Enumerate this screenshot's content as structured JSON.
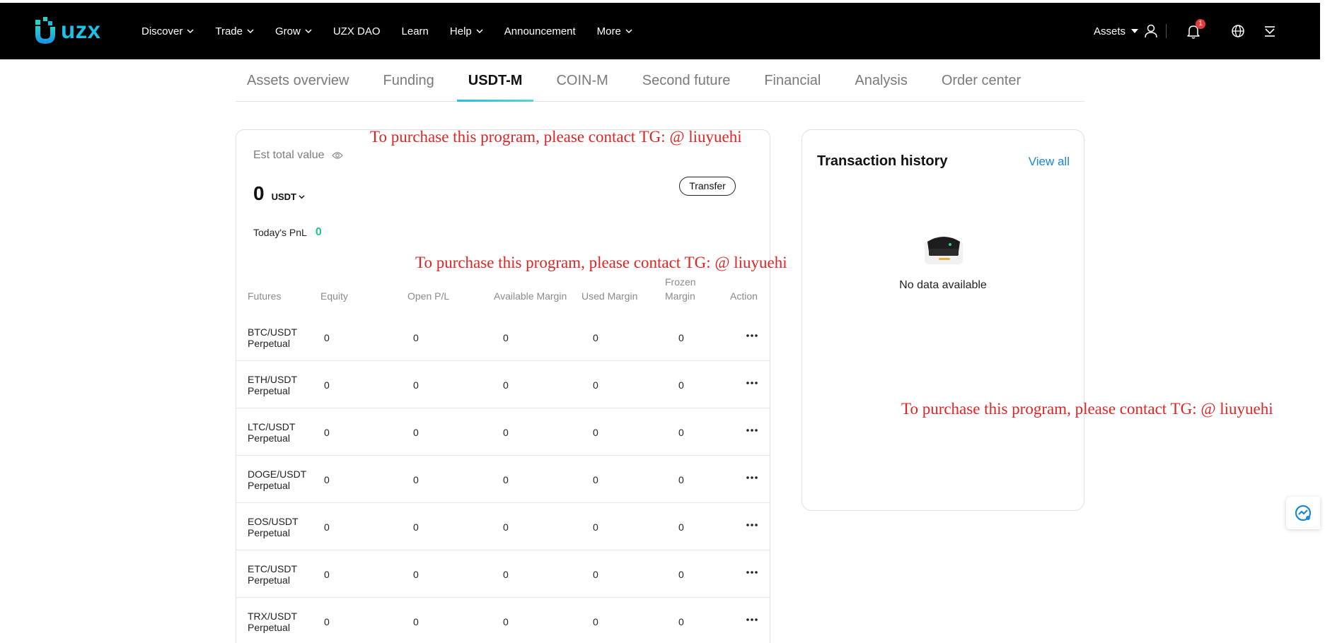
{
  "brand": {
    "name": "uzx"
  },
  "nav": {
    "items": [
      {
        "label": "Discover",
        "has_dropdown": true
      },
      {
        "label": "Trade",
        "has_dropdown": true
      },
      {
        "label": "Grow",
        "has_dropdown": true
      },
      {
        "label": "UZX DAO",
        "has_dropdown": false
      },
      {
        "label": "Learn",
        "has_dropdown": false
      },
      {
        "label": "Help",
        "has_dropdown": true
      },
      {
        "label": "Announcement",
        "has_dropdown": false
      },
      {
        "label": "More",
        "has_dropdown": true
      }
    ],
    "assets_label": "Assets",
    "notification_count": "1",
    "icons": [
      "user-icon",
      "bell-icon",
      "globe-icon",
      "download-icon"
    ]
  },
  "tabs": [
    {
      "label": "Assets overview",
      "active": false
    },
    {
      "label": "Funding",
      "active": false
    },
    {
      "label": "USDT-M",
      "active": true
    },
    {
      "label": "COIN-M",
      "active": false
    },
    {
      "label": "Second future",
      "active": false
    },
    {
      "label": "Financial",
      "active": false
    },
    {
      "label": "Analysis",
      "active": false
    },
    {
      "label": "Order center",
      "active": false
    }
  ],
  "summary": {
    "est_label": "Est total value",
    "value": "0",
    "unit": "USDT",
    "transfer_label": "Transfer",
    "pnl_label": "Today's PnL",
    "pnl_value": "0",
    "pnl_color": "#23c28e"
  },
  "table": {
    "headers": {
      "futures": "Futures",
      "equity": "Equity",
      "open_pl": "Open P/L",
      "available_margin": "Available Margin",
      "used_margin": "Used Margin",
      "frozen_margin_1": "Frozen",
      "frozen_margin_2": "Margin",
      "action": "Action"
    },
    "rows": [
      {
        "pair": "BTC/USDT",
        "type": "Perpetual",
        "equity": "0",
        "open_pl": "0",
        "available": "0",
        "used": "0",
        "frozen": "0"
      },
      {
        "pair": "ETH/USDT",
        "type": "Perpetual",
        "equity": "0",
        "open_pl": "0",
        "available": "0",
        "used": "0",
        "frozen": "0"
      },
      {
        "pair": "LTC/USDT",
        "type": "Perpetual",
        "equity": "0",
        "open_pl": "0",
        "available": "0",
        "used": "0",
        "frozen": "0"
      },
      {
        "pair": "DOGE/USDT",
        "type": "Perpetual",
        "equity": "0",
        "open_pl": "0",
        "available": "0",
        "used": "0",
        "frozen": "0"
      },
      {
        "pair": "EOS/USDT",
        "type": "Perpetual",
        "equity": "0",
        "open_pl": "0",
        "available": "0",
        "used": "0",
        "frozen": "0"
      },
      {
        "pair": "ETC/USDT",
        "type": "Perpetual",
        "equity": "0",
        "open_pl": "0",
        "available": "0",
        "used": "0",
        "frozen": "0"
      },
      {
        "pair": "TRX/USDT",
        "type": "Perpetual",
        "equity": "0",
        "open_pl": "0",
        "available": "0",
        "used": "0",
        "frozen": "0"
      }
    ]
  },
  "history": {
    "title": "Transaction history",
    "view_all": "View all",
    "empty_text": "No data available"
  },
  "watermark": {
    "text": "To purchase this program, please contact TG: @ liuyuehi",
    "color": "#e02424"
  },
  "colors": {
    "accent": "#1ec1e8",
    "link": "#1a86d8",
    "topbar": "#000000"
  }
}
